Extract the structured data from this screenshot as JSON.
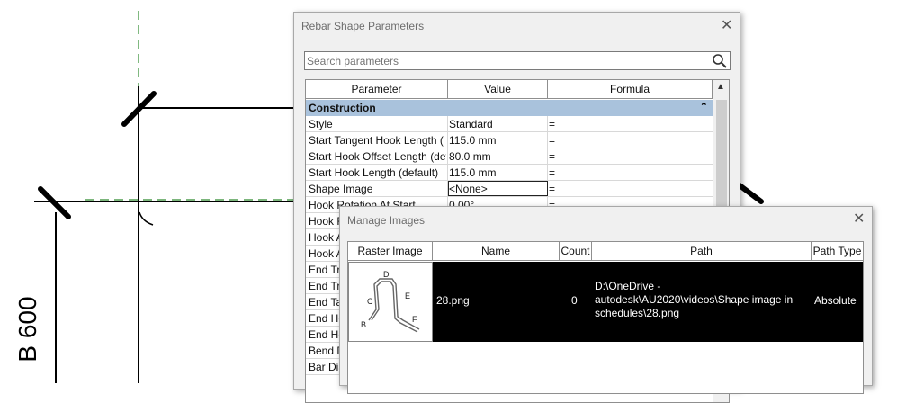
{
  "drawing": {
    "dimension_label": "B 600"
  },
  "rebar_dialog": {
    "title": "Rebar Shape Parameters",
    "search_placeholder": "Search parameters",
    "columns": [
      "Parameter",
      "Value",
      "Formula"
    ],
    "group": "Construction",
    "rows": [
      {
        "param": "Style",
        "value": "Standard",
        "formula": "="
      },
      {
        "param": "Start Tangent Hook Length (",
        "value": "115.0 mm",
        "formula": "="
      },
      {
        "param": "Start Hook Offset Length (def",
        "value": "80.0 mm",
        "formula": "="
      },
      {
        "param": "Start Hook Length (default)",
        "value": "115.0 mm",
        "formula": "="
      },
      {
        "param": "Shape Image",
        "value": "<None>",
        "formula": "="
      },
      {
        "param": "Hook Rotation At Start",
        "value": "0.00°",
        "formula": "="
      },
      {
        "param": "Hook R",
        "value": "",
        "formula": ""
      },
      {
        "param": "Hook A",
        "value": "",
        "formula": ""
      },
      {
        "param": "Hook A",
        "value": "",
        "formula": ""
      },
      {
        "param": "End Tr",
        "value": "",
        "formula": ""
      },
      {
        "param": "End Tr",
        "value": "",
        "formula": ""
      },
      {
        "param": "End Ta",
        "value": "",
        "formula": ""
      },
      {
        "param": "End He",
        "value": "",
        "formula": ""
      },
      {
        "param": "End He",
        "value": "",
        "formula": ""
      },
      {
        "param": "Bend D",
        "value": "",
        "formula": ""
      },
      {
        "param": "Bar Dia",
        "value": "",
        "formula": ""
      }
    ]
  },
  "manage_dialog": {
    "title": "Manage Images",
    "columns": [
      "Raster Image",
      "Name",
      "Count",
      "Path",
      "Path Type"
    ],
    "image_row": {
      "name": "28.png",
      "count": "0",
      "path_lines": [
        "D:\\OneDrive -",
        "autodesk\\AU2020\\videos\\Shape image in",
        "schedules\\28.png"
      ],
      "path_type": "Absolute",
      "thumb_labels": [
        "D",
        "C",
        "E",
        "B",
        "F"
      ]
    }
  },
  "colors": {
    "group_header": "#a9c2dc",
    "selected_row": "#000000",
    "guide_line": "#2e8b2e"
  }
}
